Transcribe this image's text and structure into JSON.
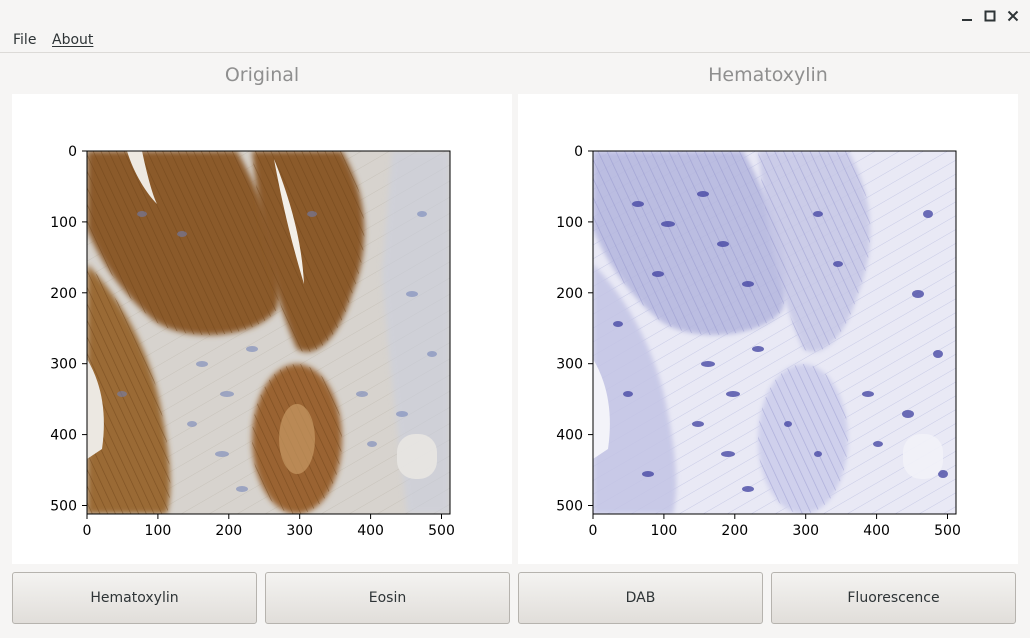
{
  "menu": {
    "file": "File",
    "about": "About"
  },
  "panels": {
    "left_title": "Original",
    "right_title": "Hematoxylin"
  },
  "chart_data": [
    {
      "type": "image",
      "title": "Original",
      "xlim": [
        0,
        512
      ],
      "ylim": [
        512,
        0
      ],
      "xticks": [
        0,
        100,
        200,
        300,
        400,
        500
      ],
      "yticks": [
        0,
        100,
        200,
        300,
        400,
        500
      ],
      "grid": false
    },
    {
      "type": "image",
      "title": "Hematoxylin",
      "xlim": [
        0,
        512
      ],
      "ylim": [
        512,
        0
      ],
      "xticks": [
        0,
        100,
        200,
        300,
        400,
        500
      ],
      "yticks": [
        0,
        100,
        200,
        300,
        400,
        500
      ],
      "grid": false
    }
  ],
  "buttons": {
    "hematoxylin": "Hematoxylin",
    "eosin": "Eosin",
    "dab": "DAB",
    "fluorescence": "Fluorescence"
  },
  "colors": {
    "window_bg": "#f6f5f4",
    "plot_bg": "#ffffff",
    "title_text": "#8f8f8f",
    "brown_stain": "#8b5a2b",
    "hematoxylin_stain": "#4b4ca8"
  },
  "icons": {
    "minimize": "minimize-icon",
    "maximize": "maximize-icon",
    "close": "close-icon"
  }
}
